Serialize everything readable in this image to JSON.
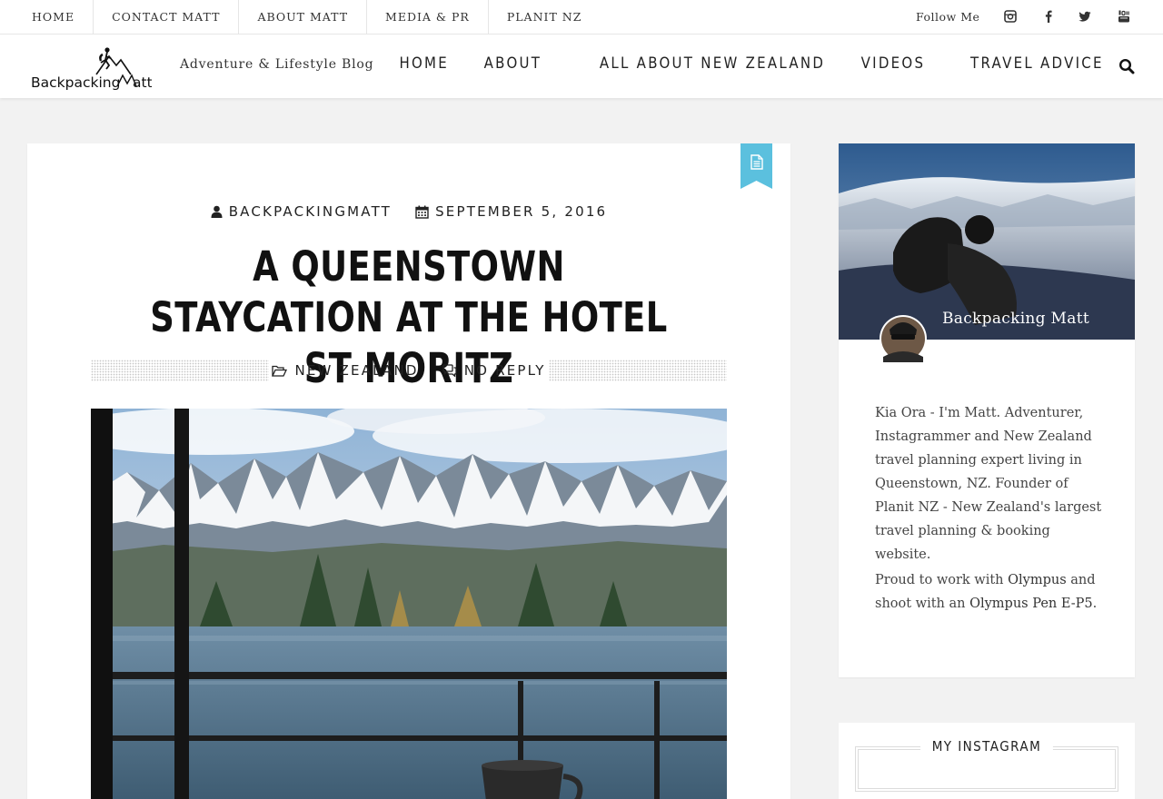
{
  "topbar": {
    "links": [
      "HOME",
      "CONTACT MATT",
      "ABOUT MATT",
      "MEDIA & PR",
      "PLANIT NZ"
    ],
    "follow_label": "Follow Me",
    "social_icons": [
      "instagram-icon",
      "facebook-icon",
      "twitter-icon",
      "youtube-icon"
    ]
  },
  "header": {
    "logo_text": "Backpacking Matt",
    "tagline": "Adventure & Lifestyle Blog",
    "nav": [
      "HOME",
      "ABOUT",
      "ALL ABOUT NEW ZEALAND",
      "VIDEOS",
      "TRAVEL ADVICE"
    ],
    "search_icon": "search-icon"
  },
  "post": {
    "format_icon": "document-icon",
    "author": "BACKPACKINGMATT",
    "date": "SEPTEMBER 5, 2016",
    "title": "A QUEENSTOWN STAYCATION AT THE HOTEL ST MORITZ",
    "category": "NEW ZEALAND",
    "comments": "NO REPLY"
  },
  "sidebar": {
    "about": {
      "name": "Backpacking Matt",
      "bio": "Kia Ora - I'm Matt. Adventurer, Instagrammer and New Zealand travel planning expert living in Queenstown, NZ. Founder of Planit NZ - New Zealand's largest travel planning & booking website.",
      "partner_prefix": "Proud to work with ",
      "partner_link": "Olympus",
      "camera_prefix": " and shoot with an ",
      "camera_link": "Olympus Pen E-P5",
      "camera_suffix": "."
    },
    "instagram_title": "MY INSTAGRAM"
  },
  "colors": {
    "ribbon": "#5bc0de",
    "background": "#f2f2f2"
  }
}
